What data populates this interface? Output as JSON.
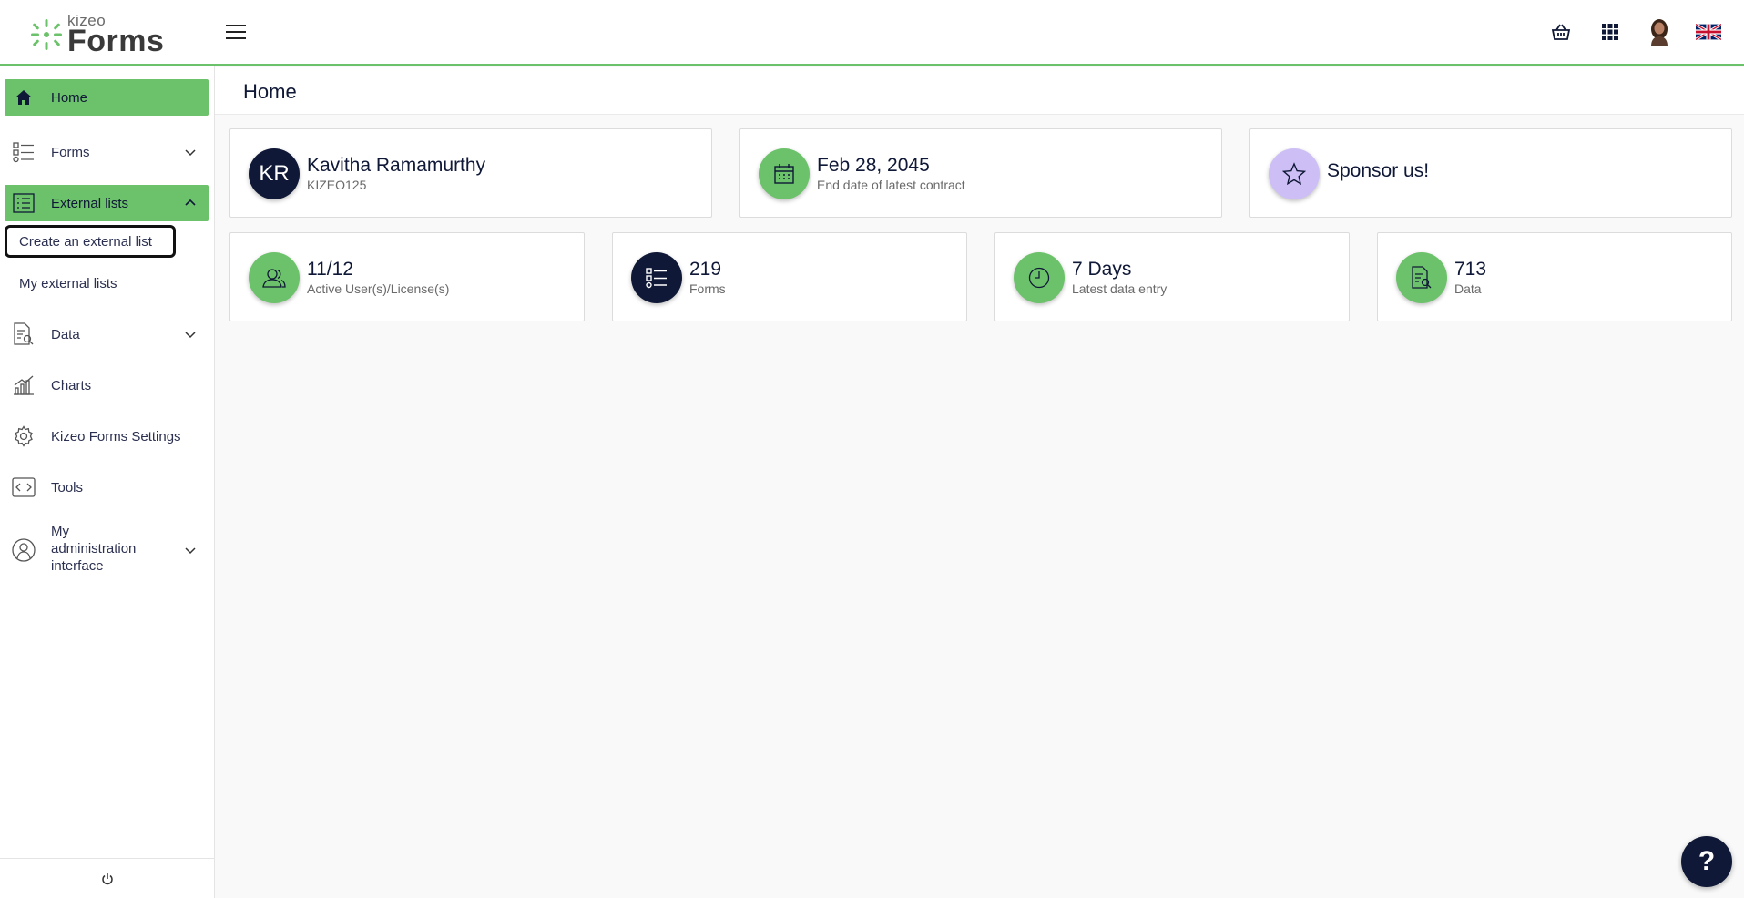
{
  "brand": {
    "small": "kizeo",
    "big": "Forms"
  },
  "header": {
    "page_title": "Home"
  },
  "top_icons": [
    "basket-icon",
    "apps-grid-icon",
    "user-avatar",
    "uk-flag-icon"
  ],
  "sidebar": {
    "items": [
      {
        "label": "Home",
        "icon": "home-icon",
        "active": true
      },
      {
        "label": "Forms",
        "icon": "forms-list-icon",
        "expandable": true
      },
      {
        "label": "External lists",
        "icon": "external-list-icon",
        "active": true,
        "expanded": true,
        "children": [
          {
            "label": "Create an external list",
            "focused": true
          },
          {
            "label": "My external lists"
          }
        ]
      },
      {
        "label": "Data",
        "icon": "data-document-icon",
        "expandable": true
      },
      {
        "label": "Charts",
        "icon": "charts-icon"
      },
      {
        "label": "Kizeo Forms Settings",
        "icon": "gear-icon"
      },
      {
        "label": "Tools",
        "icon": "code-icon"
      },
      {
        "label": "My administration interface",
        "label_lines": [
          "My",
          "administration",
          "interface"
        ],
        "icon": "admin-user-icon",
        "expandable": true
      }
    ]
  },
  "cards_top": [
    {
      "circle": "KR",
      "title": "Kavitha Ramamurthy",
      "sub": "KIZEO125",
      "color": "#0f1836"
    },
    {
      "icon": "calendar-icon",
      "title": "Feb 28, 2045",
      "sub": "End date of latest contract",
      "color": "#6cc26a"
    },
    {
      "icon": "star-icon",
      "title": "Sponsor us!",
      "color": "#cdbff5"
    }
  ],
  "cards_bottom": [
    {
      "icon": "users-icon",
      "title": "11/12",
      "sub": "Active User(s)/License(s)",
      "color": "#6cc26a"
    },
    {
      "icon": "forms-list-icon",
      "title": "219",
      "sub": "Forms",
      "color": "#0f1836"
    },
    {
      "icon": "clock-icon",
      "title": "7 Days",
      "sub": "Latest data entry",
      "color": "#6cc26a"
    },
    {
      "icon": "data-document-icon",
      "title": "713",
      "sub": "Data",
      "color": "#6cc26a"
    }
  ],
  "help": {
    "label": "?"
  }
}
